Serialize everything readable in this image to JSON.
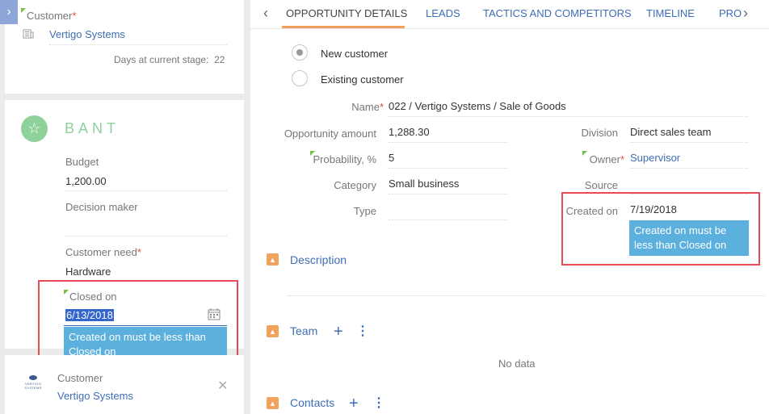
{
  "left_panel": {
    "expand_icon": "chevron-right-icon",
    "customer_card": {
      "label": "Customer",
      "required_mark": "*",
      "value": "Vertigo Systems",
      "icon": "building-icon",
      "days_label": "Days at current stage:",
      "days_value": "22"
    },
    "bant": {
      "icon": "star-icon",
      "title": "BANT",
      "budget_label": "Budget",
      "budget_value": "1,200.00",
      "decision_maker_label": "Decision maker",
      "decision_maker_value": "",
      "customer_need_label": "Customer need",
      "customer_need_required": "*",
      "customer_need_value": "Hardware",
      "closed_on_label": "Closed on",
      "closed_on_value": "6/13/2018",
      "calendar_icon": "calendar-icon",
      "error": "Created on must be less than Closed on"
    },
    "customer_mini": {
      "logo_text": "VERTIGO SYSTEMS",
      "label": "Customer",
      "value": "Vertigo Systems",
      "close_icon": "close-icon"
    }
  },
  "tabs": {
    "prev_icon": "chevron-left-icon",
    "next_icon": "chevron-right-icon",
    "items": [
      "OPPORTUNITY DETAILS",
      "LEADS",
      "TACTICS AND COMPETITORS",
      "TIMELINE",
      "PROI"
    ]
  },
  "form": {
    "new_customer": "New customer",
    "existing_customer": "Existing customer",
    "name_label": "Name",
    "name_required": "*",
    "name_value": "022 / Vertigo Systems / Sale of Goods",
    "amount_label": "Opportunity amount",
    "amount_value": "1,288.30",
    "probability_label": "Probability, %",
    "probability_value": "5",
    "category_label": "Category",
    "category_value": "Small business",
    "type_label": "Type",
    "type_value": "",
    "division_label": "Division",
    "division_value": "Direct sales team",
    "owner_label": "Owner",
    "owner_required": "*",
    "owner_value": "Supervisor",
    "source_label": "Source",
    "source_value": "",
    "created_on_label": "Created on",
    "created_on_value": "7/19/2018",
    "created_on_error": "Created on must be less than Closed on"
  },
  "sections": {
    "description": "Description",
    "team": "Team",
    "team_empty": "No data",
    "contacts": "Contacts"
  },
  "colors": {
    "accent_orange": "#f0a05a",
    "link_blue": "#3d6db5",
    "error_blue": "#5bb0dd",
    "highlight_red": "#e84b55",
    "bant_green": "#8ed19a"
  }
}
